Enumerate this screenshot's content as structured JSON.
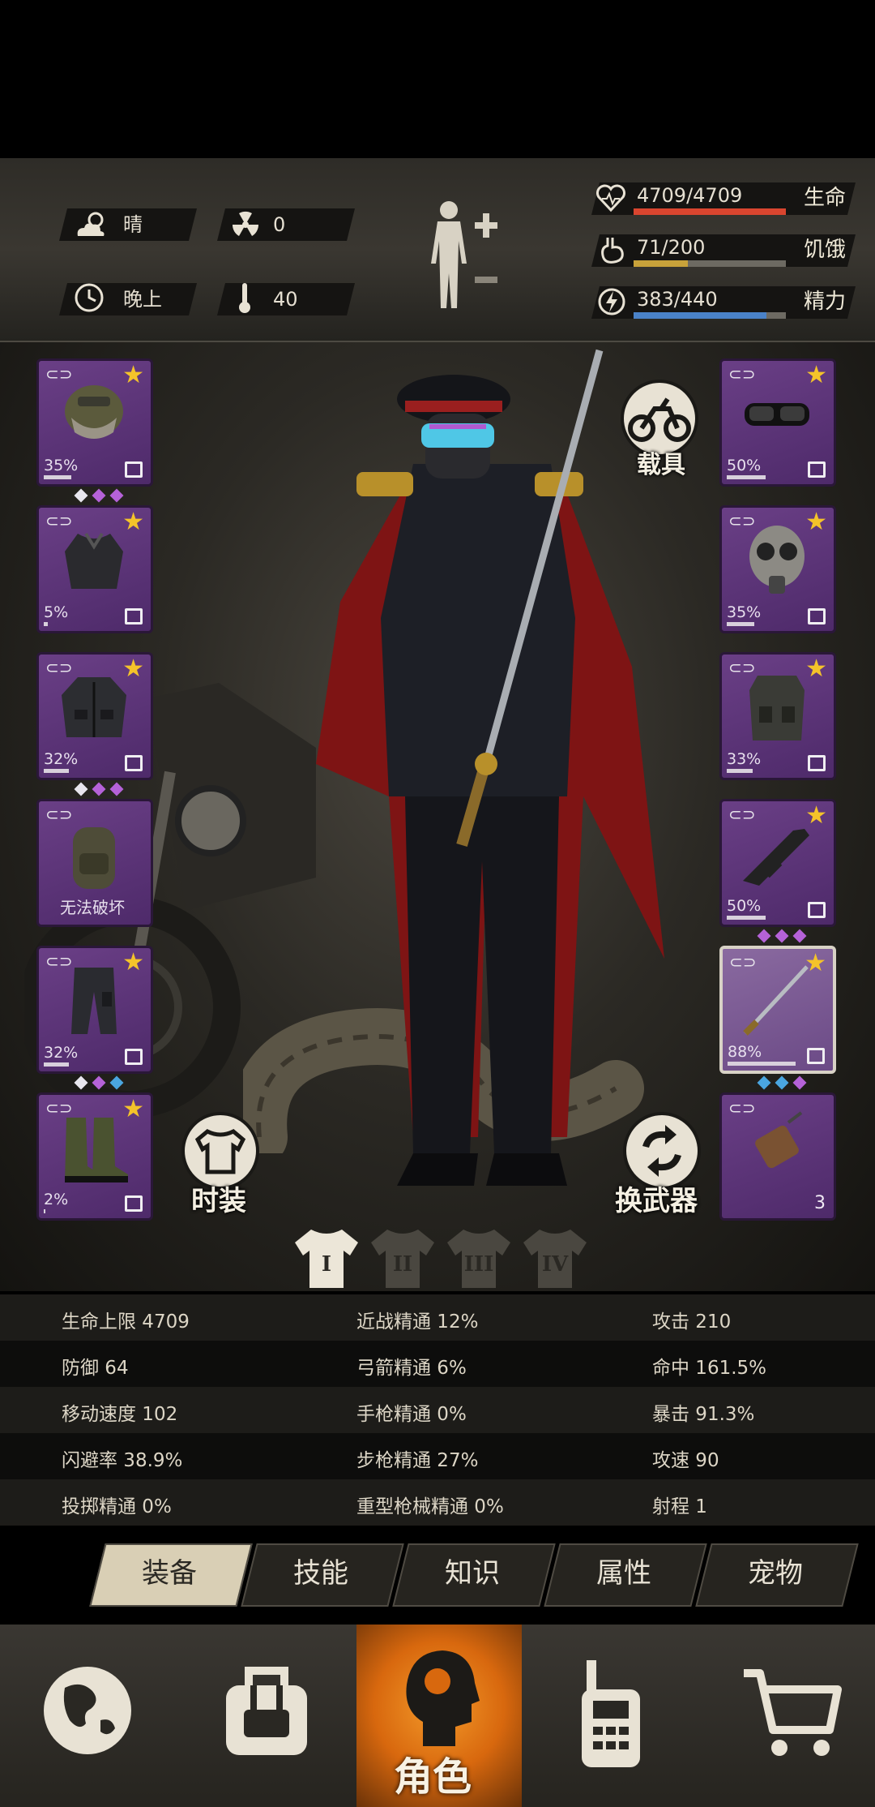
{
  "status": {
    "weather": "晴",
    "radiation": "0",
    "time_of_day": "晚上",
    "temperature": "40",
    "health": {
      "text": "4709/4709",
      "label": "生命",
      "fraction": 1.0,
      "color": "#d9452f"
    },
    "hunger": {
      "text": "71/200",
      "label": "饥饿",
      "fraction": 0.355,
      "color": "#c8a23a"
    },
    "energy": {
      "text": "383/440",
      "label": "精力",
      "fraction": 0.87,
      "color": "#4a82c8"
    }
  },
  "left_slots": [
    {
      "item": "helmet",
      "pct": "35%",
      "fill": 0.35,
      "starred": true,
      "gems": [
        "white",
        "purple",
        "purple"
      ]
    },
    {
      "item": "sweater",
      "pct": "5%",
      "fill": 0.05,
      "starred": true,
      "gems": []
    },
    {
      "item": "jacket",
      "pct": "32%",
      "fill": 0.32,
      "starred": true,
      "gems": [
        "white",
        "purple",
        "purple"
      ]
    },
    {
      "item": "backpack",
      "pct": "",
      "fill": 0,
      "starred": false,
      "note": "无法破坏",
      "gems": []
    },
    {
      "item": "pants",
      "pct": "32%",
      "fill": 0.32,
      "starred": true,
      "gems": [
        "white",
        "purple",
        "blue"
      ]
    },
    {
      "item": "boots",
      "pct": "2%",
      "fill": 0.02,
      "starred": true,
      "gems": []
    }
  ],
  "right_slots": [
    {
      "item": "goggles",
      "pct": "50%",
      "fill": 0.5,
      "starred": true,
      "gems": []
    },
    {
      "item": "gas-mask",
      "pct": "35%",
      "fill": 0.35,
      "starred": true,
      "gems": []
    },
    {
      "item": "vest",
      "pct": "33%",
      "fill": 0.33,
      "starred": true,
      "gems": []
    },
    {
      "item": "rifle",
      "pct": "50%",
      "fill": 0.5,
      "starred": true,
      "gems": [
        "purple",
        "purple",
        "purple"
      ]
    },
    {
      "item": "katana",
      "pct": "88%",
      "fill": 0.88,
      "starred": true,
      "selected": true,
      "gems": [
        "blue",
        "blue",
        "purple"
      ]
    },
    {
      "item": "explosive",
      "pct": "",
      "fill": 0,
      "starred": false,
      "count": "3",
      "gems": []
    }
  ],
  "buttons": {
    "vehicle": "载具",
    "costume": "时装",
    "swap_weapon": "换武器"
  },
  "outfit_tabs": [
    "I",
    "II",
    "III",
    "IV"
  ],
  "stats": [
    [
      "生命上限 4709",
      "近战精通 12%",
      "攻击 210"
    ],
    [
      "防御 64",
      "弓箭精通 6%",
      "命中 161.5%"
    ],
    [
      "移动速度 102",
      "手枪精通 0%",
      "暴击 91.3%"
    ],
    [
      "闪避率 38.9%",
      "步枪精通 27%",
      "攻速 90"
    ],
    [
      "投掷精通 0%",
      "重型枪械精通 0%",
      "射程 1"
    ]
  ],
  "tabs": [
    "装备",
    "技能",
    "知识",
    "属性",
    "宠物"
  ],
  "active_tab": 0,
  "nav": {
    "character_label": "角色"
  },
  "colors": {
    "slot_purple": "#5e3579",
    "gem_white": "#e8e6ee",
    "gem_purple": "#b562d8",
    "gem_blue": "#4aa6e0",
    "star": "#f4c32a",
    "nav_active": "#e07a18"
  }
}
